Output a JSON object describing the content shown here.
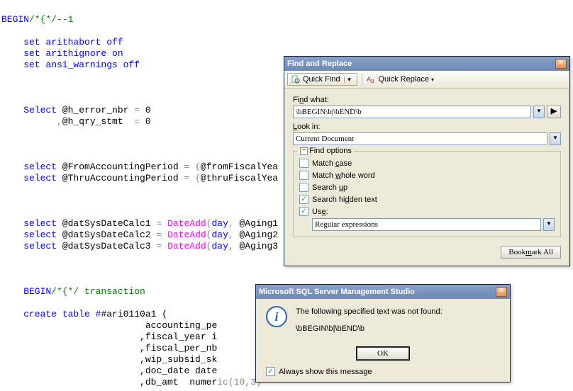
{
  "code": {
    "line1_kw": "BEGIN",
    "line1_cm": "/*{*/--1",
    "l3": "    set arithabort off",
    "l4": "    set arithignore on",
    "l5": "    set ansi_warnings off",
    "l9a": "    Select ",
    "l9b": "@h_error_nbr ",
    "l9c": "= ",
    "l9d": "0",
    "l10a": "          ,",
    "l10b": "@h_qry_stmt  ",
    "l10c": "= ",
    "l10d": "0",
    "l14a": "    select ",
    "l14b": "@FromAccountingPeriod ",
    "l14c": "= (",
    "l14d": "@fromFiscalYea",
    "l15a": "    select ",
    "l15b": "@ThruAccountingPeriod ",
    "l15c": "= (",
    "l15d": "@thruFiscalYea",
    "l19a": "    select ",
    "l19b": "@datSysDateCalc1 ",
    "l19c": "= ",
    "l19fn": "DateAdd",
    "l19p": "(",
    "l19dy": "day",
    "l19cm": ", ",
    "l19ag": "@Aging1",
    "l20a": "    select ",
    "l20b": "@datSysDateCalc2 ",
    "l20c": "= ",
    "l20fn": "DateAdd",
    "l20p": "(",
    "l20dy": "day",
    "l20cm": ", ",
    "l20ag": "@Aging2",
    "l21a": "    select ",
    "l21b": "@datSysDateCalc3 ",
    "l21c": "= ",
    "l21fn": "DateAdd",
    "l21p": "(",
    "l21dy": "day",
    "l21cm": ", ",
    "l21ag": "@Aging3",
    "l25_kw": "    BEGIN",
    "l25_cm": "/*{*/ transaction",
    "l27a": "    create table #",
    "l27b": "#ari0110a1 (",
    "l28": "                          accounting_pe",
    "l29": "                         ,fiscal_year i",
    "l30": "                         ,fiscal_per_nb",
    "l31": "                         ,wip_subsid_sk",
    "l32": "                         ,doc_date date",
    "l33a": "                         ,db_amt  numer",
    "l33b": "ic(10,3)"
  },
  "find": {
    "title": "Find and Replace",
    "quickFind": "Quick Find",
    "quickReplace": "Quick Replace",
    "findWhat": "Find what:",
    "findValue": "\\bBEGIN\\b|\\bEND\\b",
    "lookIn": "Look in:",
    "lookInValue": "Current Document",
    "options": "Find options",
    "matchCase": "Match case",
    "matchWhole": "Match whole word",
    "searchUp": "Search up",
    "searchHidden": "Search hidden text",
    "use": "Use:",
    "useValue": "Regular expressions",
    "findNext": "Find Next",
    "bookmarkAll": "Bookmark All"
  },
  "msg": {
    "title": "Microsoft SQL Server Management Studio",
    "text1": "The following specified text was not found:",
    "text2": "\\bBEGIN\\b|\\bEND\\b",
    "ok": "OK",
    "always": "Always show this message"
  }
}
